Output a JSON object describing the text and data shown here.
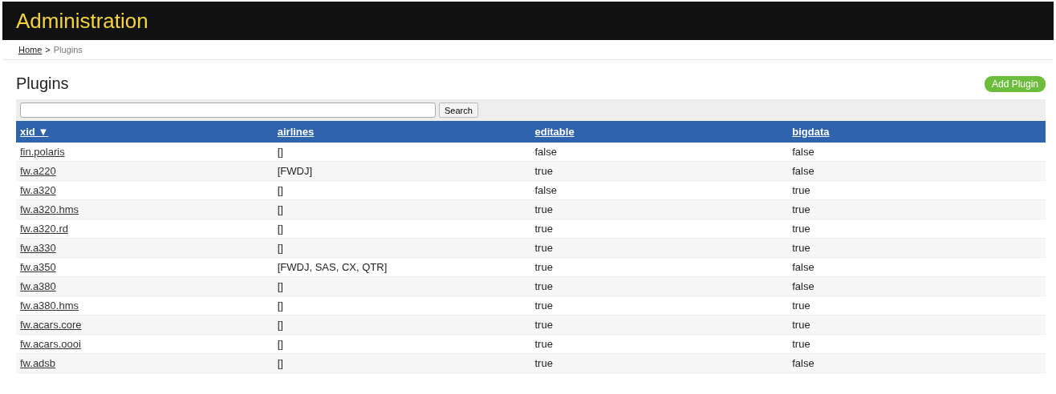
{
  "header": {
    "title": "Administration"
  },
  "breadcrumb": {
    "link": "Home",
    "separator": ">",
    "current": "Plugins"
  },
  "page_title": "Plugins",
  "add_button": "Add Plugin",
  "search": {
    "button": "Search"
  },
  "table": {
    "columns": [
      "xid ▼",
      "airlines",
      "editable",
      "bigdata"
    ],
    "rows": [
      [
        "fin.polaris",
        "[]",
        "false",
        "false"
      ],
      [
        "fw.a220",
        "[FWDJ]",
        "true",
        "false"
      ],
      [
        "fw.a320",
        "[]",
        "false",
        "true"
      ],
      [
        "fw.a320.hms",
        "[]",
        "true",
        "true"
      ],
      [
        "fw.a320.rd",
        "[]",
        "true",
        "true"
      ],
      [
        "fw.a330",
        "[]",
        "true",
        "true"
      ],
      [
        "fw.a350",
        "[FWDJ, SAS, CX, QTR]",
        "true",
        "false"
      ],
      [
        "fw.a380",
        "[]",
        "true",
        "false"
      ],
      [
        "fw.a380.hms",
        "[]",
        "true",
        "true"
      ],
      [
        "fw.acars.core",
        "[]",
        "true",
        "true"
      ],
      [
        "fw.acars.oooi",
        "[]",
        "true",
        "true"
      ],
      [
        "fw.adsb",
        "[]",
        "true",
        "false"
      ]
    ]
  }
}
